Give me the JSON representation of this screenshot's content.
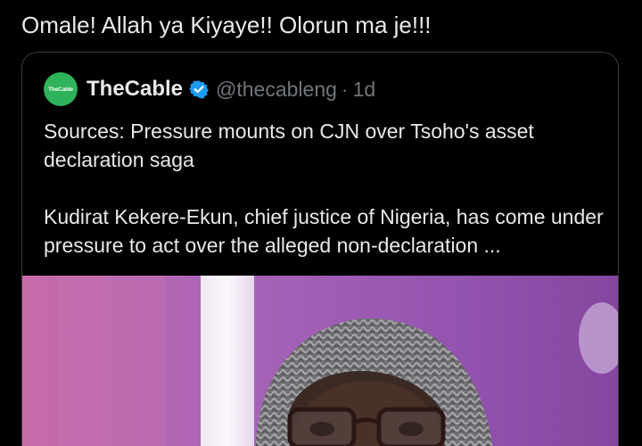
{
  "post": {
    "text": "Omale! Allah ya Kiyaye!! Olorun ma je!!!"
  },
  "quoted_post": {
    "avatar_text": "TheCable",
    "display_name": "TheCable",
    "verified": true,
    "handle": "@thecableng",
    "separator": "·",
    "age": "1d",
    "headline": "Sources: Pressure mounts on CJN over Tsoho's asset declaration saga",
    "summary": "Kudirat Kekere-Ekun, chief justice of Nigeria, has come under pressure to act over the alleged non-declaration ..."
  },
  "icons": {
    "verified": "verified-badge-icon",
    "verified_color": "#1d9bf0"
  },
  "colors": {
    "background": "#000000",
    "text": "#e7e9ea",
    "secondary_text": "#71767b",
    "avatar_green": "#2fb35a",
    "card_border": "#3a3d42"
  }
}
